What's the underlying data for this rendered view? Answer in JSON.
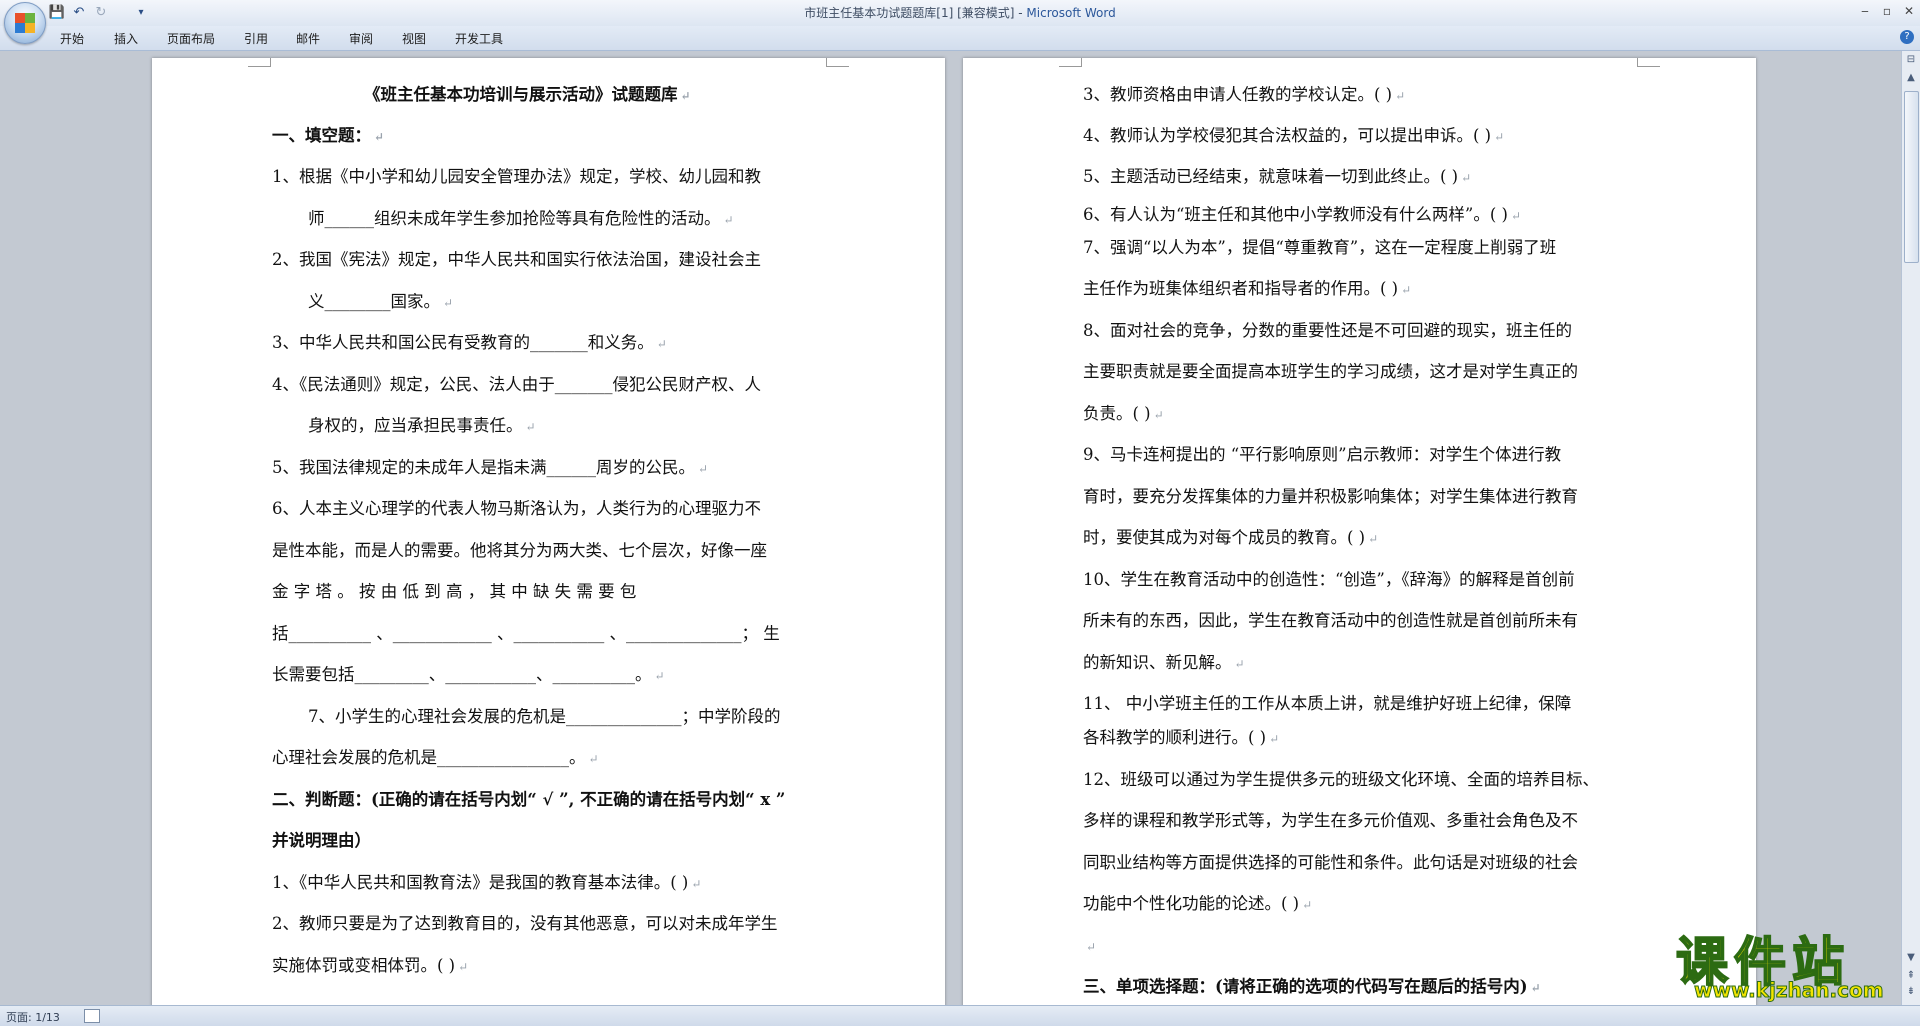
{
  "window": {
    "title_doc": "市班主任基本功试题题库[1] [兼容模式] - ",
    "title_app": "Microsoft Word",
    "ctl_min": "‒",
    "ctl_max": "▫",
    "ctl_close": "✕"
  },
  "quick_access": {
    "save_icon": "💾",
    "undo_icon": "↶",
    "redo_icon": "↻",
    "customize_icon": "▾"
  },
  "menu": [
    "开始",
    "插入",
    "页面布局",
    "引用",
    "邮件",
    "审阅",
    "视图",
    "开发工具"
  ],
  "help_icon": "?",
  "page_left": {
    "title": "《班主任基本功培训与展示活动》试题题库",
    "sec1": "一、填空题：",
    "q1a": "1、根据《中小学和幼儿园安全管理办法》规定，学校、幼儿园和教",
    "q1b": "师______组织未成年学生参加抢险等具有危险性的活动。",
    "q2a": "2、我国《宪法》规定，中华人民共和国实行依法治国，建设社会主",
    "q2b": "义________国家。",
    "q3": "3、中华人民共和国公民有受教育的_______和义务。",
    "q4a": "4、《民法通则》规定，公民、法人由于_______侵犯公民财产权、人",
    "q4b": "身权的，应当承担民事责任。",
    "q5": "5、我国法律规定的未成年人是指未满______周岁的公民。",
    "q6a": "6、人本主义心理学的代表人物马斯洛认为，人类行为的心理驱力不",
    "q6b": "是性本能，而是人的需要。他将其分为两大类、七个层次，好像一座",
    "q6c": "金 字 塔 。 按 由 低 到 高 ， 其 中 缺 失 需 要 包",
    "q6d": "括__________ 、____________ 、___________ 、______________；   生",
    "q6e": "长需要包括_________、___________、__________。",
    "q7a": "7、小学生的心理社会发展的危机是______________；中学阶段的",
    "q7b": "心理社会发展的危机是________________。",
    "sec2a": "二、判断题：(正确的请在括号内划“ √ ”, 不正确的请在括号内划“ x ”",
    "sec2b": "并说明理由）",
    "j1": "1、《中华人民共和国教育法》是我国的教育基本法律。(      )",
    "j2a": "2、教师只要是为了达到教育目的，没有其他恶意，可以对未成年学生",
    "j2b": "实施体罚或变相体罚。(      )"
  },
  "page_right": {
    "j3": "3、教师资格由申请人任教的学校认定。(      )",
    "j4": "4、教师认为学校侵犯其合法权益的，可以提出申诉。(      )",
    "j5": "5、主题活动已经结束，就意味着一切到此终止。(   )",
    "j6": "6、有人认为“班主任和其他中小学教师没有什么两样”。(    )",
    "j7a": "7、强调“以人为本”，提倡“尊重教育”，这在一定程度上削弱了班",
    "j7b": "主任作为班集体组织者和指导者的作用。(      )",
    "j8a": "8、面对社会的竞争，分数的重要性还是不可回避的现实，班主任的",
    "j8b": "主要职责就是要全面提高本班学生的学习成绩，这才是对学生真正的",
    "j8c": "负责。(      )",
    "j9a": "9、马卡连柯提出的 “平行影响原则”启示教师：对学生个体进行教",
    "j9b": "育时，要充分发挥集体的力量并积极影响集体；对学生集体进行教育",
    "j9c": "时，要使其成为对每个成员的教育。(   )",
    "j10a": "10、学生在教育活动中的创造性：“创造”，《辞海》的解释是首创前",
    "j10b": "所未有的东西，因此，学生在教育活动中的创造性就是首创前所未有",
    "j10c": "的新知识、新见解。",
    "j11a": "11、  中小学班主任的工作从本质上讲，就是维护好班上纪律，保障",
    "j11b": "各科教学的顺利进行。(      )",
    "j12a": "12、班级可以通过为学生提供多元的班级文化环境、全面的培养目标、",
    "j12b": "多样的课程和教学形式等，为学生在多元价值观、多重社会角色及不",
    "j12c": "同职业结构等方面提供选择的可能性和条件。此句话是对班级的社会",
    "j12d": "功能中个性化功能的论述。(      )",
    "sec3": "三、单项选择题：(请将正确的选项的代码写在题后的括号内)"
  },
  "para_mark": "↵",
  "status": {
    "page": "页面: 1/13"
  },
  "watermark": {
    "main": "课件站",
    "url": "www.kjzhan.com"
  },
  "colors": {
    "ribbon": "#dce6f4",
    "workspace": "#c3c9d2",
    "watermark_yellow": "#f2e400",
    "watermark_outline": "#2c6b12"
  }
}
